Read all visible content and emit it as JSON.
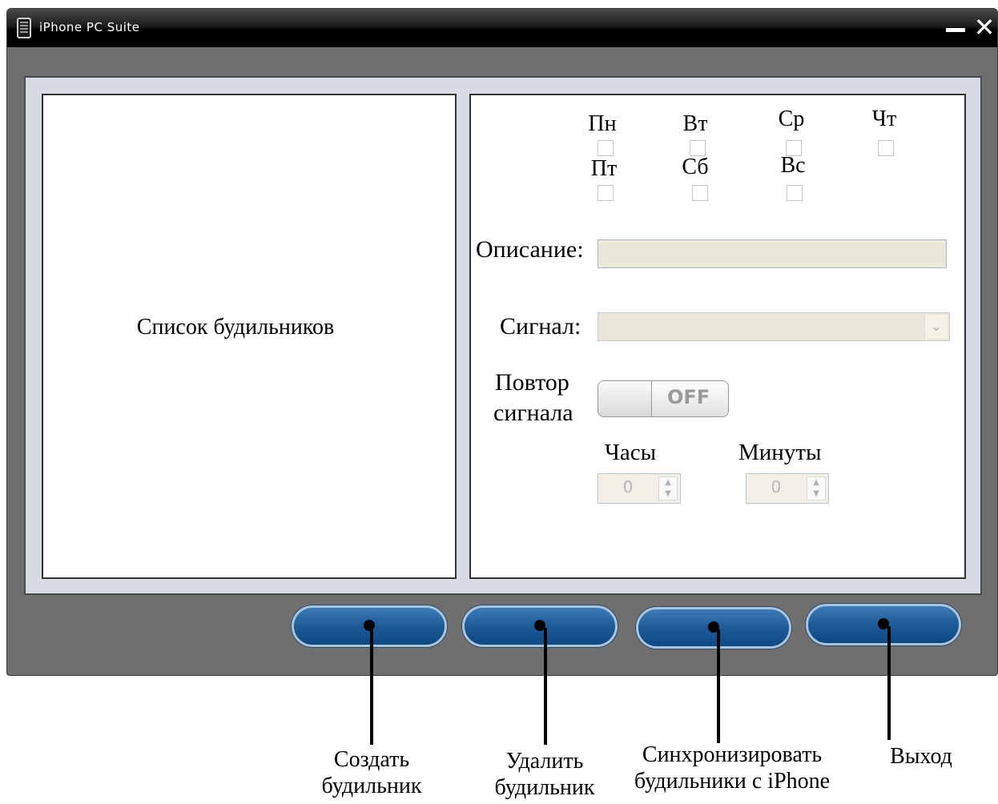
{
  "window": {
    "title": "iPhone PC Suite"
  },
  "alarm_list": {
    "title": "Список будильников"
  },
  "days": [
    {
      "label": "Пн"
    },
    {
      "label": "Вт"
    },
    {
      "label": "Ср"
    },
    {
      "label": "Чт"
    },
    {
      "label": "Пт"
    },
    {
      "label": "Сб"
    },
    {
      "label": "Вс"
    }
  ],
  "form": {
    "description_label": "Описание:",
    "description_value": "",
    "signal_label": "Сигнал:",
    "signal_value": "",
    "repeat_label_line1": "Повтор",
    "repeat_label_line2": "сигнала",
    "repeat_toggle": "OFF",
    "hours_label": "Часы",
    "hours_value": "0",
    "minutes_label": "Минуты",
    "minutes_value": "0"
  },
  "callouts": {
    "create_line1": "Создать",
    "create_line2": "будильник",
    "delete_line1": "Удалить",
    "delete_line2": "будильник",
    "sync_line1": "Синхронизировать",
    "sync_line2": "будильники с iPhone",
    "exit": "Выход"
  },
  "colors": {
    "button_blue": "#1c5b98",
    "panel_bg": "#d6dbe4",
    "frame_gray": "#6f6f6f"
  }
}
